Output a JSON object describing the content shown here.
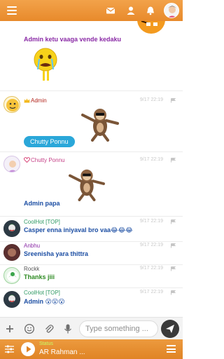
{
  "header": {
    "icons": [
      "menu-icon",
      "mail-icon",
      "user-icon",
      "bell-icon",
      "profile-avatar"
    ]
  },
  "messages": [
    {
      "type": "continued",
      "text": "Admin ketu vaaga vende kedaku",
      "sticker": "crying-emoji-sticker"
    },
    {
      "type": "message",
      "username": "Admin",
      "badge": "crown-icon",
      "time": "9/17 22:19",
      "chip": "Chutty Ponnu",
      "sticker": "monkey-sticker"
    },
    {
      "type": "message",
      "username": "Chutty Ponnu",
      "badge": "heart-icon",
      "time": "9/17 22:19",
      "text": "Admin papa",
      "sticker": "monkey-sticker"
    },
    {
      "type": "message",
      "username": "CoolHot [TOP]",
      "time": "9/17 22:19",
      "text": "Casper enna iniyaval bro vaa😂😂😂"
    },
    {
      "type": "message",
      "username": "Anbhu",
      "time": "9/17 22:19",
      "text": "Sreenisha yara thittra"
    },
    {
      "type": "message",
      "username": "Rockk",
      "time": "9/17 22:19",
      "text": "Thanks jiii"
    },
    {
      "type": "message",
      "username": "CoolHot [TOP]",
      "time": "9/17 22:19",
      "text": "Admin 😮😮😮"
    }
  ],
  "input": {
    "placeholder": "Type something ..."
  },
  "player": {
    "status": "Status",
    "track": "AR Rahman ..."
  },
  "colors": {
    "accent": "#e88a2b",
    "message_text": "#1c4ea3",
    "chip": "#2aa7d9",
    "admin": "#b3261e"
  }
}
